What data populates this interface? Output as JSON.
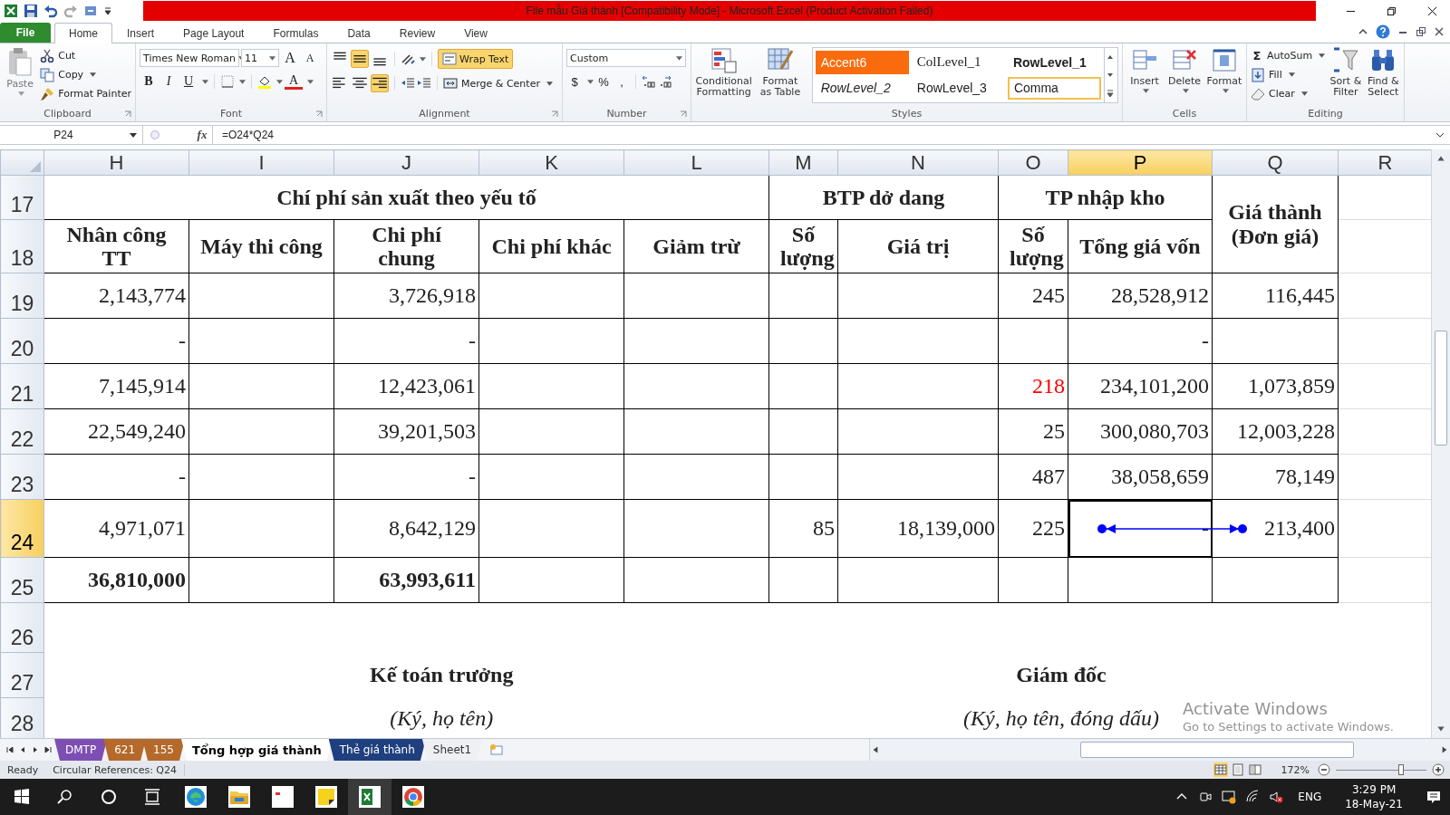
{
  "window": {
    "title": "File mẫu Giá thành  [Compatibility Mode]  -  Microsoft Excel (Product Activation Failed)"
  },
  "menu_tabs": [
    {
      "label": "File",
      "kind": "file",
      "selected": false
    },
    {
      "label": "Home",
      "kind": "tab",
      "selected": true
    },
    {
      "label": "Insert",
      "kind": "tab",
      "selected": false
    },
    {
      "label": "Page Layout",
      "kind": "tab",
      "selected": false
    },
    {
      "label": "Formulas",
      "kind": "tab",
      "selected": false
    },
    {
      "label": "Data",
      "kind": "tab",
      "selected": false
    },
    {
      "label": "Review",
      "kind": "tab",
      "selected": false
    },
    {
      "label": "View",
      "kind": "tab",
      "selected": false
    }
  ],
  "ribbon": {
    "clipboard": {
      "paste": "Paste",
      "cut": "Cut",
      "copy": "Copy",
      "format_painter": "Format Painter",
      "label": "Clipboard"
    },
    "font": {
      "family": "Times New Roman",
      "size": "11",
      "grow": "A",
      "shrink": "A",
      "bold": "B",
      "italic": "I",
      "underline": "U",
      "color_letter": "A",
      "label": "Font"
    },
    "alignment": {
      "vertical": [
        {
          "kind": "top",
          "selected": false
        },
        {
          "kind": "middle",
          "selected": true
        },
        {
          "kind": "bottom",
          "selected": false
        }
      ],
      "horizontal": [
        {
          "kind": "left",
          "selected": false
        },
        {
          "kind": "center",
          "selected": false
        },
        {
          "kind": "right",
          "selected": true
        }
      ],
      "wrap_text": {
        "label": "Wrap Text",
        "selected": true
      },
      "merge": "Merge & Center",
      "label": "Alignment"
    },
    "number": {
      "format": "Custom",
      "currency": "$",
      "percent": "%",
      "comma": ",",
      "label": "Number"
    },
    "styles": {
      "conditional": "Conditional Formatting",
      "format_table": "Format as Table",
      "label": "Styles",
      "cells": [
        {
          "text": "Accent6",
          "kind": "accent",
          "selected": false
        },
        {
          "text": "ColLevel_1",
          "kind": "serif",
          "selected": false
        },
        {
          "text": "RowLevel_1",
          "kind": "bold",
          "selected": false
        },
        {
          "text": "RowLevel_2",
          "kind": "italic",
          "selected": false
        },
        {
          "text": "RowLevel_3",
          "kind": "plain",
          "selected": false
        },
        {
          "text": "Comma",
          "kind": "plain",
          "selected": true
        }
      ]
    },
    "cells": {
      "label": "Cells",
      "buttons": [
        {
          "label": "Insert",
          "kind": "insert"
        },
        {
          "label": "Delete",
          "kind": "delete"
        },
        {
          "label": "Format",
          "kind": "format"
        }
      ]
    },
    "editing": {
      "sigma": "Σ",
      "autosum": "AutoSum",
      "fill": "Fill",
      "clear": "Clear",
      "sort": "Sort & Filter",
      "find": "Find & Select",
      "label": "Editing"
    }
  },
  "formula_bar": {
    "name_box": "P24",
    "fx": "fx",
    "formula": "=O24*Q24"
  },
  "table": {
    "columns": [
      {
        "letter": "H",
        "selected": false
      },
      {
        "letter": "I",
        "selected": false
      },
      {
        "letter": "J",
        "selected": false
      },
      {
        "letter": "K",
        "selected": false
      },
      {
        "letter": "L",
        "selected": false
      },
      {
        "letter": "M",
        "selected": false
      },
      {
        "letter": "N",
        "selected": false
      },
      {
        "letter": "O",
        "selected": false
      },
      {
        "letter": "P",
        "selected": true
      },
      {
        "letter": "Q",
        "selected": false
      },
      {
        "letter": "R",
        "selected": false
      }
    ],
    "header_rows": [
      {
        "number": "17",
        "selected": false
      },
      {
        "number": "18",
        "selected": false
      }
    ],
    "group_headers": [
      "Chí phí sản xuất theo yếu tố",
      "BTP dở dang",
      "TP nhập kho",
      "Giá thành (Đơn giá)"
    ],
    "sub_headers": [
      "Nhân công TT",
      "Máy thi công",
      "Chi phí chung",
      "Chi phí khác",
      "Giảm trừ",
      "Số lượng",
      "Giá trị",
      "Số lượng",
      "Tổng giá vốn"
    ],
    "body_rows": [
      {
        "number": "19",
        "selected": false,
        "cells": [
          "2,143,774",
          "",
          "3,726,918",
          "",
          "",
          "",
          "",
          "245",
          "28,528,912",
          "116,445"
        ]
      },
      {
        "number": "20",
        "selected": false,
        "cells": [
          "-",
          "",
          "-",
          "",
          "",
          "",
          "",
          "",
          "-",
          ""
        ]
      },
      {
        "number": "21",
        "selected": false,
        "cells": [
          "7,145,914",
          "",
          "12,423,061",
          "",
          "",
          "",
          "",
          {
            "text": "218",
            "flagged": true
          },
          "234,101,200",
          "1,073,859"
        ]
      },
      {
        "number": "22",
        "selected": false,
        "cells": [
          "22,549,240",
          "",
          "39,201,503",
          "",
          "",
          "",
          "",
          "25",
          "300,080,703",
          "12,003,228"
        ]
      },
      {
        "number": "23",
        "selected": false,
        "cells": [
          "-",
          "",
          "-",
          "",
          "",
          "",
          "",
          "487",
          "38,058,659",
          "78,149"
        ]
      },
      {
        "number": "24",
        "selected": true,
        "trace_arrow": true,
        "cells": [
          "4,971,071",
          "",
          "8,642,129",
          "",
          "",
          "85",
          "18,139,000",
          "225",
          "-",
          "213,400"
        ]
      },
      {
        "number": "25",
        "selected": false,
        "total": true,
        "cells": [
          "36,810,000",
          "",
          "63,993,611",
          "",
          "",
          "",
          "",
          "",
          "",
          ""
        ]
      }
    ],
    "signature_rows": [
      {
        "number": "26",
        "selected": false
      },
      {
        "number": "27",
        "selected": false,
        "kind": "title",
        "left": "Kế toán trưởng",
        "right": "Giám đốc"
      },
      {
        "number": "28",
        "selected": false,
        "kind": "note",
        "left": "(Ký, họ tên)",
        "right": "(Ký, họ tên, đóng dấu)"
      }
    ]
  },
  "sheet_tabs": [
    {
      "label": "DMTP",
      "color": "#7e4fb2",
      "selected": false
    },
    {
      "label": "621",
      "color": "#b5692a",
      "selected": false
    },
    {
      "label": "155",
      "color": "#b5692a",
      "selected": false
    },
    {
      "label": "Tổng hợp giá thành",
      "selected": true
    },
    {
      "label": "Thẻ giá thành",
      "color": "#1f3f7f",
      "selected": false
    },
    {
      "label": "Sheet1",
      "selected": false
    }
  ],
  "status_bar": {
    "ready": "Ready",
    "circular": "Circular References: Q24",
    "zoom": "172%"
  },
  "activation": {
    "title": "Activate Windows",
    "hint": "Go to Settings to activate Windows."
  },
  "taskbar": {
    "language": "ENG",
    "time": "3:29 PM",
    "date": "18-May-21"
  }
}
